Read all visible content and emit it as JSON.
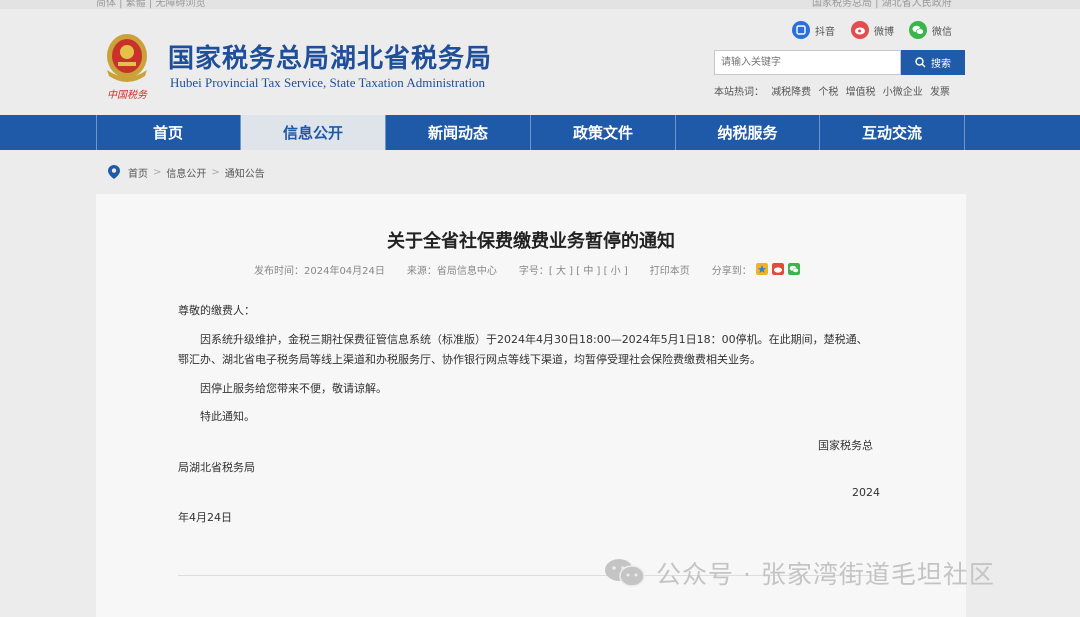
{
  "site": {
    "title_cn": "国家税务总局湖北省税务局",
    "title_en": "Hubei Provincial Tax Service, State Taxation Administration",
    "logo_text": "中国税务"
  },
  "topstrip": {
    "left_text": "简体 | 繁體 | 无障碍浏览",
    "right_text": "国家税务总局 | 湖北省人民政府"
  },
  "social": [
    {
      "label": "抖音",
      "icon": "douyin-icon",
      "color": "#2a6fdc"
    },
    {
      "label": "微博",
      "icon": "weibo-icon",
      "color": "#e14e4e"
    },
    {
      "label": "微信",
      "icon": "weixin-icon",
      "color": "#3bb44a"
    }
  ],
  "search": {
    "placeholder": "请输入关键字",
    "button_label": "搜索"
  },
  "hot": {
    "label": "本站热词：",
    "terms": [
      "减税降费",
      "个税",
      "增值税",
      "小微企业",
      "发票"
    ]
  },
  "nav": {
    "items": [
      {
        "label": "首页"
      },
      {
        "label": "信息公开",
        "active": true
      },
      {
        "label": "新闻动态"
      },
      {
        "label": "政策文件"
      },
      {
        "label": "纳税服务"
      },
      {
        "label": "互动交流"
      }
    ],
    "color": "#1e5aa8"
  },
  "breadcrumb": {
    "items": [
      "首页",
      "信息公开",
      "通知公告"
    ],
    "separator": ">"
  },
  "article": {
    "title": "关于全省社保费缴费业务暂停的通知",
    "meta": {
      "date_label": "发布时间：",
      "date": "2024年04月24日",
      "source_label": "来源：",
      "source": "省局信息中心",
      "font_size_label": "字号：",
      "font_size_options": "[ 大 ] [ 中 ] [ 小 ]",
      "print_label": "打印本页",
      "share_label": "分享到："
    },
    "greeting": "尊敬的缴费人：",
    "paragraph1_line1": "因系统升级维护，金税三期社保费征管信息系统（标准版）于2024年4月30日18:00—2024年5月1日18：00停机。在此期间，楚税通、",
    "paragraph1_line2": "鄂汇办、湖北省电子税务局等线上渠道和办税服务厅、协作银行网点等线下渠道，均暂停受理社会保险费缴费相关业务。",
    "paragraph2": "因停止服务给您带来不便，敬请谅解。",
    "paragraph3": "特此通知。",
    "sign_part1": "国家税务总",
    "sign_part2": "局湖北省税务局",
    "date_part1": "2024",
    "date_part2": "年4月24日"
  },
  "watermark": {
    "text": "公众号 · 张家湾街道毛坦社区",
    "icon": "wechat-icon"
  }
}
